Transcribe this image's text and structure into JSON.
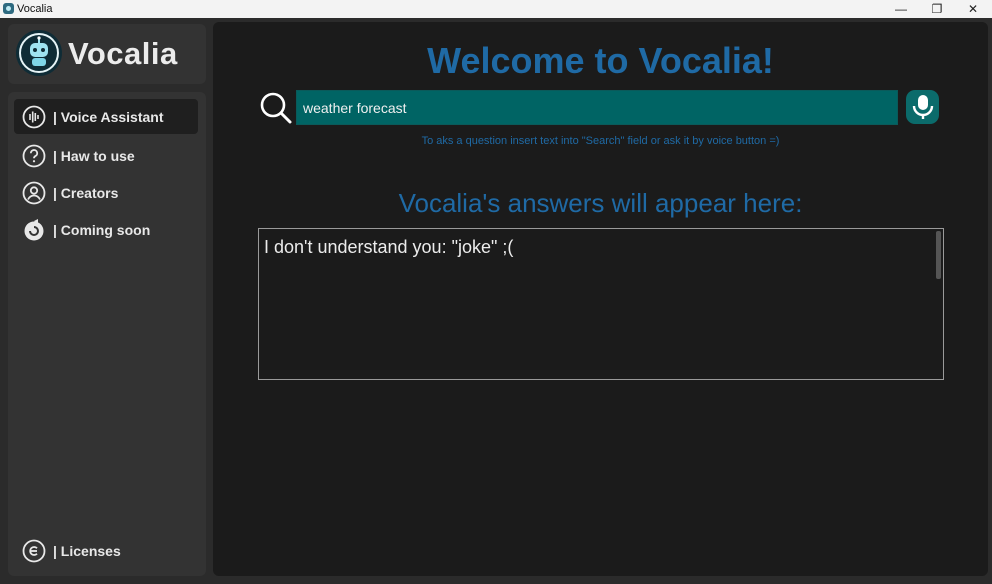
{
  "window": {
    "title": "Vocalia",
    "minimize_glyph": "—",
    "restore_glyph": "❐",
    "close_glyph": "✕"
  },
  "logo": {
    "text": "Vocalia",
    "icon": "robot-logo-icon"
  },
  "nav": {
    "items": [
      {
        "label": "| Voice Assistant",
        "icon": "soundwave-icon",
        "active": true
      },
      {
        "label": "| Haw to use",
        "icon": "question-icon",
        "active": false
      },
      {
        "label": "| Creators",
        "icon": "user-circle-icon",
        "active": false
      },
      {
        "label": "| Coming soon",
        "icon": "refresh-icon",
        "active": false
      }
    ],
    "footer": {
      "label": "| Licenses",
      "icon": "copyright-icon"
    }
  },
  "main": {
    "welcome": "Welcome to Vocalia!",
    "search": {
      "value": "weather forecast",
      "placeholder": ""
    },
    "hint": "To aks a question insert text into \"Search\" field or ask it by voice button =)",
    "answers_title": "Vocalia's answers will appear here:",
    "answer_text": "I don't understand you: \"joke\" ;("
  },
  "colors": {
    "accent": "#1f6aa5",
    "search_bg": "#006464",
    "panel": "#333333",
    "main_bg": "#1b1b1b"
  }
}
